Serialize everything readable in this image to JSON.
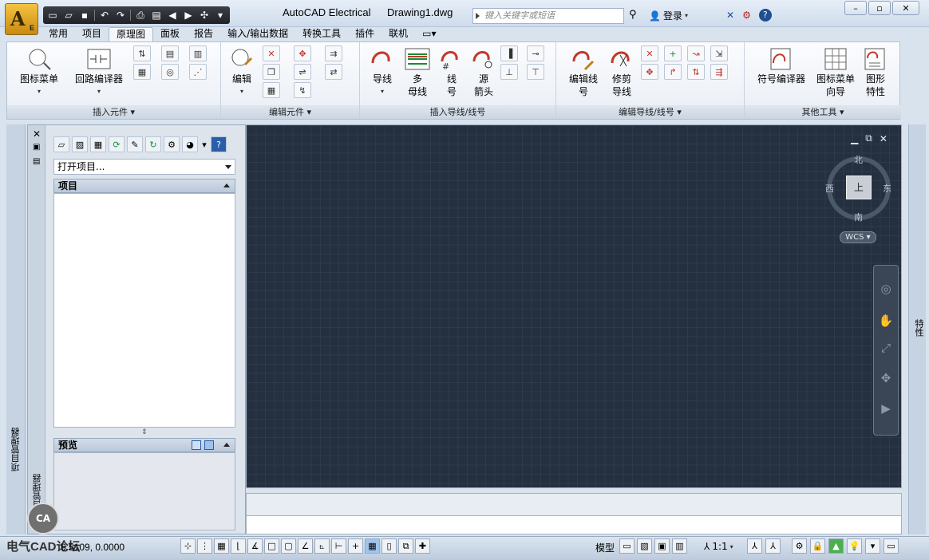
{
  "titlebar": {
    "app_title": "AutoCAD Electrical",
    "doc_title": "Drawing1.dwg",
    "search_placeholder": "键入关键字或短语",
    "login": "登录",
    "app_letter": "A",
    "app_badge": "E"
  },
  "tabs": [
    "常用",
    "项目",
    "原理图",
    "面板",
    "报告",
    "输入/输出数据",
    "转换工具",
    "插件",
    "联机"
  ],
  "ribbon": {
    "insert_components": {
      "title": "插入元件",
      "btn1": "图标菜单",
      "btn2": "回路编译器"
    },
    "edit_components": {
      "title": "编辑元件",
      "btn1": "编辑"
    },
    "insert_wires": {
      "title": "插入导线/线号",
      "btn1": "导线",
      "btn2_l1": "多",
      "btn2_l2": "母线",
      "btn3_l1": "线",
      "btn3_l2": "号",
      "btn4_l1": "源",
      "btn4_l2": "箭头"
    },
    "edit_wires": {
      "title": "编辑导线/线号",
      "btn1_l1": "编辑线",
      "btn1_l2": "号",
      "btn2_l1": "修剪",
      "btn2_l2": "导线"
    },
    "other_tools": {
      "title": "其他工具",
      "btn1": "符号编译器",
      "btn2_l1": "图标菜单",
      "btn2_l2": "向导",
      "btn3_l1": "图形",
      "btn3_l2": "特性"
    }
  },
  "project_manager": {
    "vertical_label": "项目管理器",
    "open_project": "打开项目...",
    "projects_header": "项目",
    "preview_header": "预览"
  },
  "properties_label": "特性",
  "viewcube": {
    "north": "北",
    "south": "南",
    "east": "东",
    "west": "西",
    "face": "上",
    "wcs": "WCS"
  },
  "status": {
    "coords": "6.5109,  0.0000",
    "model": "模型",
    "scale": "1:1"
  },
  "watermark": {
    "text": "电气CAD论坛",
    "logo": "CA"
  },
  "colors": {
    "canvas_bg": "#243040",
    "accent_red": "#c0392b",
    "app_orange": "#e8a824"
  }
}
